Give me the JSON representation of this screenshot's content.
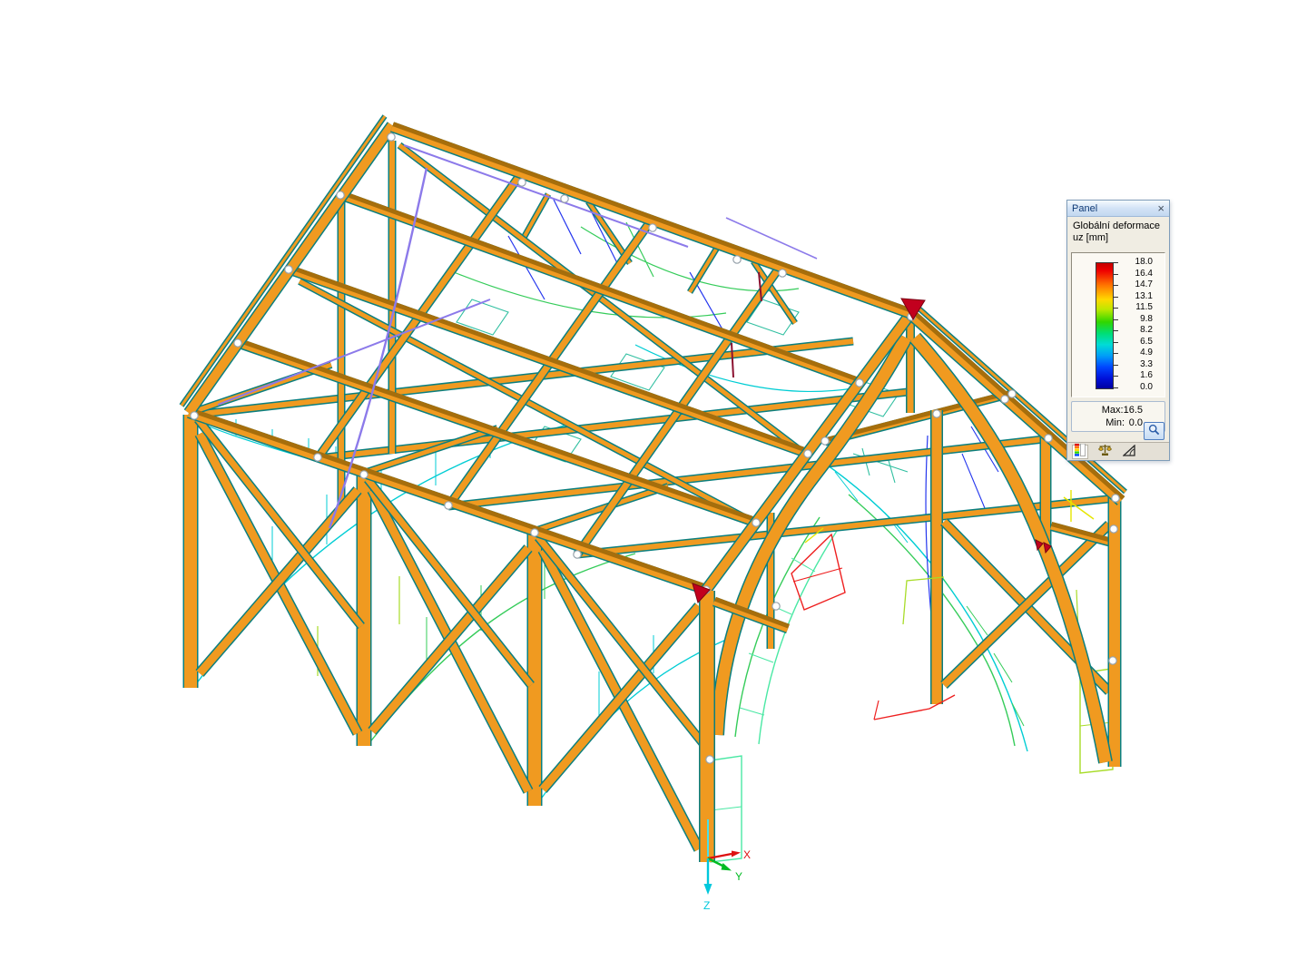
{
  "panel": {
    "title": "Panel",
    "close_label": "×",
    "legend_title": "Globální deformace",
    "legend_subtitle": "uz [mm]",
    "scale_ticks": [
      "18.0",
      "16.4",
      "14.7",
      "13.1",
      "11.5",
      "9.8",
      "8.2",
      "6.5",
      "4.9",
      "3.3",
      "1.6",
      "0.0"
    ],
    "gradient_stops": [
      "#C40000 0%",
      "#EF0000 6%",
      "#FF7800 18%",
      "#FFD800 29%",
      "#BCE800 37%",
      "#30D600 47%",
      "#00DE74 56%",
      "#00DCD6 65%",
      "#009EF8 74%",
      "#0046FF 83%",
      "#0011DA 92%",
      "#0000A2 100%"
    ],
    "max_label": "Max:",
    "max_value": "16.5",
    "min_label": "Min:",
    "min_value": "0.0",
    "tabs": [
      {
        "id": "color-scale",
        "selected": true
      },
      {
        "id": "balance",
        "selected": false
      },
      {
        "id": "angle",
        "selected": false
      }
    ]
  },
  "axes": {
    "x": "X",
    "y": "Y",
    "z": "Z"
  },
  "colors": {
    "background": "#FFFFFF",
    "beam": "#F09A20",
    "beam_edge": "#0B7F7F",
    "beam_dark": "#A66E0C",
    "node_fill": "#FFFFFF",
    "node_ring": "#97A2AB",
    "marker": "#C2001E",
    "deform": {
      "cyan": "#00CDD4",
      "teal": "#2FBFA0",
      "green": "#35CC5A",
      "springgreen": "#4AE8A4",
      "yellowgreen": "#A8DC28",
      "yellow": "#E6E600",
      "red": "#EE2020",
      "darkred": "#8B1030",
      "blue": "#2436EE",
      "violet": "#8C7AEA",
      "lightcyan": "#49E0E6"
    },
    "axis": {
      "x": "#DD1111",
      "y": "#00BB22",
      "z": "#00C8DC"
    }
  }
}
